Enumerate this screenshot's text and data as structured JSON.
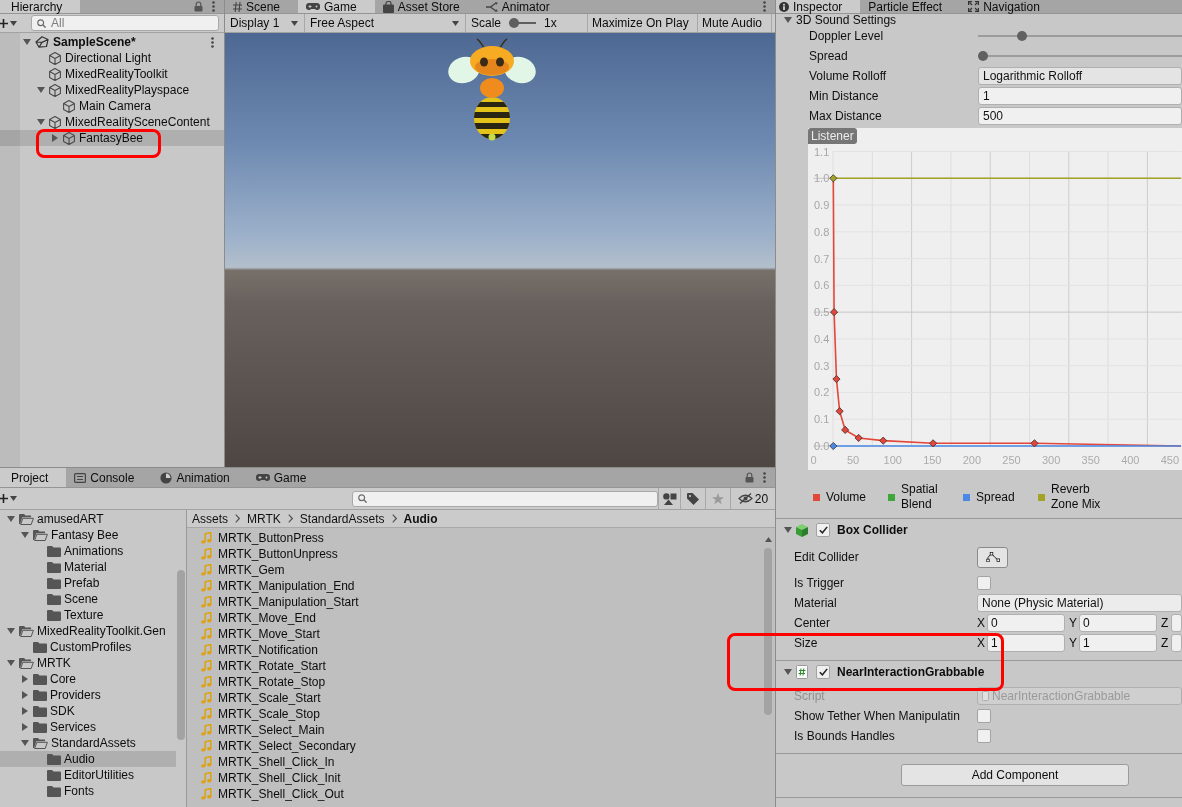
{
  "hierarchy": {
    "tab": {
      "label": "Hierarchy",
      "selected": true
    },
    "search": {
      "placeholder": "All"
    },
    "items": [
      {
        "label": "SampleScene*",
        "kind": "scene",
        "expanded": true,
        "selected": false,
        "highlighted": false,
        "children": [
          {
            "label": "Directional Light",
            "kind": "object",
            "selected": false,
            "highlighted": false
          },
          {
            "label": "MixedRealityToolkit",
            "kind": "object",
            "selected": false,
            "highlighted": false
          },
          {
            "label": "MixedRealityPlayspace",
            "kind": "object",
            "expanded": true,
            "selected": false,
            "highlighted": false,
            "children": [
              {
                "label": "Main Camera",
                "kind": "object",
                "selected": false,
                "highlighted": false
              }
            ]
          },
          {
            "label": "MixedRealitySceneContent",
            "kind": "object",
            "expanded": true,
            "selected": false,
            "highlighted": false,
            "children": [
              {
                "label": "FantasyBee",
                "kind": "object",
                "expanded": false,
                "selected": true,
                "highlighted": true
              }
            ]
          }
        ]
      }
    ]
  },
  "game_view": {
    "tabs": [
      {
        "label": "Scene",
        "kind": "scene",
        "selected": false
      },
      {
        "label": "Game",
        "kind": "game",
        "selected": true
      },
      {
        "label": "Asset Store",
        "kind": "store",
        "selected": false
      },
      {
        "label": "Animator",
        "kind": "animator",
        "selected": false
      }
    ],
    "toolbar": {
      "display": "Display 1",
      "aspect": "Free Aspect",
      "scale": {
        "label": "Scale",
        "level": 0,
        "reading": "1x"
      },
      "toggles": [
        {
          "label": "Maximize On Play",
          "on": false
        },
        {
          "label": "Mute Audio",
          "on": false
        }
      ]
    }
  },
  "project": {
    "tabs": [
      {
        "label": "Project",
        "kind": "project",
        "selected": true
      },
      {
        "label": "Console",
        "kind": "console",
        "selected": false
      },
      {
        "label": "Animation",
        "kind": "animation",
        "selected": false
      },
      {
        "label": "Game",
        "kind": "game",
        "selected": false
      }
    ],
    "hidden_count": "20",
    "folders": [
      {
        "label": "amusedART",
        "expanded": true,
        "selected": false,
        "children": [
          {
            "label": "Fantasy Bee",
            "expanded": true,
            "selected": false,
            "children": [
              {
                "label": "Animations",
                "selected": false
              },
              {
                "label": "Material",
                "selected": false
              },
              {
                "label": "Prefab",
                "selected": false
              },
              {
                "label": "Scene",
                "selected": false
              },
              {
                "label": "Texture",
                "selected": false
              }
            ]
          }
        ]
      },
      {
        "label": "MixedRealityToolkit.Gen",
        "expanded": true,
        "selected": false,
        "children": [
          {
            "label": "CustomProfiles",
            "selected": false
          }
        ]
      },
      {
        "label": "MRTK",
        "expanded": true,
        "selected": false,
        "children": [
          {
            "label": "Core",
            "expanded": false,
            "selected": false
          },
          {
            "label": "Providers",
            "expanded": false,
            "selected": false
          },
          {
            "label": "SDK",
            "expanded": false,
            "selected": false
          },
          {
            "label": "Services",
            "expanded": false,
            "selected": false
          },
          {
            "label": "StandardAssets",
            "expanded": true,
            "selected": false,
            "children": [
              {
                "label": "Audio",
                "selected": true
              },
              {
                "label": "EditorUtilities",
                "selected": false
              },
              {
                "label": "Fonts",
                "selected": false
              }
            ]
          }
        ]
      }
    ],
    "breadcrumb": [
      {
        "label": "Assets",
        "current": false
      },
      {
        "label": "MRTK",
        "current": false
      },
      {
        "label": "StandardAssets",
        "current": false
      },
      {
        "label": "Audio",
        "current": true
      }
    ],
    "files": [
      {
        "name": "MRTK_ButtonPress",
        "selected": false
      },
      {
        "name": "MRTK_ButtonUnpress",
        "selected": false
      },
      {
        "name": "MRTK_Gem",
        "selected": false
      },
      {
        "name": "MRTK_Manipulation_End",
        "selected": false
      },
      {
        "name": "MRTK_Manipulation_Start",
        "selected": false
      },
      {
        "name": "MRTK_Move_End",
        "selected": false
      },
      {
        "name": "MRTK_Move_Start",
        "selected": false
      },
      {
        "name": "MRTK_Notification",
        "selected": false
      },
      {
        "name": "MRTK_Rotate_Start",
        "selected": false
      },
      {
        "name": "MRTK_Rotate_Stop",
        "selected": false
      },
      {
        "name": "MRTK_Scale_Start",
        "selected": false
      },
      {
        "name": "MRTK_Scale_Stop",
        "selected": false
      },
      {
        "name": "MRTK_Select_Main",
        "selected": false
      },
      {
        "name": "MRTK_Select_Secondary",
        "selected": false
      },
      {
        "name": "MRTK_Shell_Click_In",
        "selected": false
      },
      {
        "name": "MRTK_Shell_Click_Init",
        "selected": false
      },
      {
        "name": "MRTK_Shell_Click_Out",
        "selected": false
      }
    ]
  },
  "inspector": {
    "tabs": [
      {
        "label": "Inspector",
        "kind": "info",
        "selected": true
      },
      {
        "label": "Particle Effect",
        "kind": "plain",
        "selected": false
      },
      {
        "label": "Navigation",
        "kind": "navigation",
        "selected": false
      }
    ],
    "sound_settings": {
      "title": "3D Sound Settings",
      "expanded": true,
      "rows": [
        {
          "label": "Doppler Level",
          "kind": "slider",
          "level": 0.2
        },
        {
          "label": "Spread",
          "kind": "slider",
          "level": 0
        },
        {
          "label": "Volume Rolloff",
          "kind": "dropdown",
          "value": "Logarithmic Rolloff"
        },
        {
          "label": "Min Distance",
          "kind": "number",
          "value": "1"
        },
        {
          "label": "Max Distance",
          "kind": "number",
          "value": "500"
        }
      ]
    },
    "rolloff_graph": {
      "tag": "Listener",
      "chart_data": {
        "type": "line",
        "grid": true,
        "xlim": [
          0,
          465
        ],
        "ylim": [
          0,
          1.1
        ],
        "xticks": [
          0,
          50,
          100,
          150,
          200,
          250,
          300,
          350,
          400,
          450
        ],
        "yticks": [
          {
            "value": 0,
            "label": "0.0"
          },
          {
            "value": 0.1,
            "label": "0.1"
          },
          {
            "value": 0.2,
            "label": "0.2"
          },
          {
            "value": 0.3,
            "label": "0.3"
          },
          {
            "value": 0.4,
            "label": "0.4"
          },
          {
            "value": 0.5,
            "label": "0.5"
          },
          {
            "value": 0.6,
            "label": "0.6"
          },
          {
            "value": 0.7,
            "label": "0.7"
          },
          {
            "value": 0.8,
            "label": "0.8"
          },
          {
            "value": 0.9,
            "label": "0.9"
          },
          {
            "value": 1,
            "label": "1.0"
          },
          {
            "value": 1.1,
            "label": "1.1"
          }
        ],
        "series": [
          {
            "name": "Volume",
            "color": "#e3463a",
            "marker": "diamond",
            "x": [
              25,
              26,
              29,
              33,
              40,
              57,
              88,
              151,
              279,
              464
            ],
            "values": [
              1,
              0.5,
              0.25,
              0.13,
              0.06,
              0.03,
              0.02,
              0.01,
              0.01,
              0
            ]
          },
          {
            "name": "Spatial Blend",
            "color": "#3fa63a"
          },
          {
            "name": "Spread",
            "color": "#4a8ae6",
            "marker": "diamond",
            "x": [
              25,
              464
            ],
            "values": [
              0,
              0
            ]
          },
          {
            "name": "Reverb Zone Mix",
            "color": "#a3a328",
            "marker": "diamond",
            "x": [
              25,
              464
            ],
            "values": [
              1,
              1
            ]
          }
        ]
      }
    },
    "components": [
      {
        "title": "Box Collider",
        "kind": "collider",
        "expanded": true,
        "enabled": true,
        "highlighted": false,
        "rows": [
          {
            "label": "Edit Collider",
            "kind": "edit_button"
          },
          {
            "label": "Is Trigger",
            "kind": "checkbox",
            "checked": false
          },
          {
            "label": "Material",
            "kind": "object",
            "value": "None (Physic Material)"
          },
          {
            "label": "Center",
            "kind": "vector3",
            "axes": [
              {
                "label": "X",
                "value": "0"
              },
              {
                "label": "Y",
                "value": "0"
              },
              {
                "label": "Z"
              }
            ]
          },
          {
            "label": "Size",
            "kind": "vector3",
            "axes": [
              {
                "label": "X",
                "value": "1"
              },
              {
                "label": "Y",
                "value": "1"
              },
              {
                "label": "Z"
              }
            ]
          }
        ]
      },
      {
        "title": "NearInteractionGrabbable",
        "kind": "script",
        "expanded": true,
        "enabled": true,
        "highlighted": true,
        "rows": [
          {
            "label": "Script",
            "kind": "script_ref",
            "value": "NearInteractionGrabbable",
            "disabled": true
          },
          {
            "label": "Show Tether When Manipulatin",
            "kind": "checkbox",
            "checked": false,
            "disabled": false
          },
          {
            "label": "Is Bounds Handles",
            "kind": "checkbox",
            "checked": false,
            "disabled": false
          }
        ]
      }
    ],
    "add_component": "Add Component"
  }
}
